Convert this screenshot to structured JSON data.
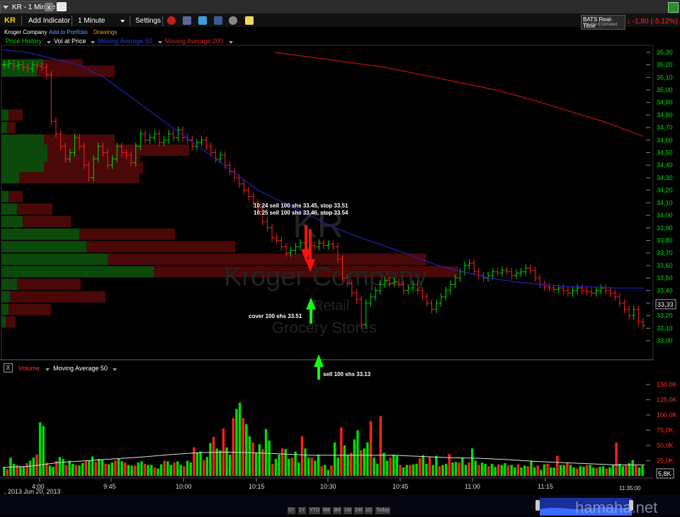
{
  "tab": {
    "title": "KR - 1 Minute",
    "close": "x"
  },
  "toolbar": {
    "symbol": "KR",
    "add_indicator": "Add Indicator",
    "interval": "1 Minute",
    "settings": "Settings"
  },
  "feed": {
    "label": "BATS Real-Time",
    "sub": "Volume Estimated",
    "change": "-1,80 (-5,12%)",
    "change_color": "#ff2a2a"
  },
  "links": {
    "company": "Kroger Company",
    "portfolio": "Add to Portfolio",
    "drawings": "Drawings"
  },
  "legend": {
    "price_history": "Price History",
    "vol_at_price": "Vol at Price",
    "ma50": "Moving Average 50",
    "ma200": "Moving Average 200"
  },
  "volume_legend": {
    "close": "X",
    "volume": "Volume",
    "ma50": "Moving Average 50"
  },
  "watermark_text": {
    "symbol": "KR",
    "name": "Kroger Company",
    "sector": "Retail",
    "industry": "Grocery Stores"
  },
  "annotations": {
    "sell1": "10:24 sell 100 shs 33.45, stop 33.51",
    "sell2": "10:25 sell 100 shs 33.46, stop 33.54",
    "cover": "cover 100 shs 33.51",
    "sell3": "sell 100 shs 33.13"
  },
  "date_label": ", 2013  Jun 20, 2013",
  "timestamp": "11:35:00",
  "range_buttons": [
    "5Y",
    "1Y",
    "YTD",
    "6M",
    "3M",
    "1M",
    "1W",
    "1D",
    "Today"
  ],
  "site_watermark": "hamaha.net",
  "colors": {
    "up": "#00dd00",
    "down": "#ff2020",
    "ma50": "#2020c0",
    "ma200": "#c01010",
    "vol_ma": "#dddddd",
    "axis_text": "#00e000",
    "vol_axis_text": "#ff3030"
  },
  "chart_data": [
    {
      "type": "candlestick",
      "title": "KR - 1 Minute",
      "x_ticks": [
        "4:00",
        "9:45",
        "10:00",
        "10:15",
        "10:30",
        "10:45",
        "11:00",
        "11:15"
      ],
      "y_ticks": [
        "35,30",
        "35,20",
        "35,10",
        "35,00",
        "34,90",
        "34,80",
        "34,70",
        "34,60",
        "34,50",
        "34,40",
        "34,30",
        "34,20",
        "34,10",
        "34,00",
        "33,90",
        "33,80",
        "33,70",
        "33,60",
        "33,50",
        "33,40",
        "33,30",
        "33,20",
        "33,10",
        "33,00"
      ],
      "ylim": [
        32.95,
        35.35
      ],
      "last_price": "33,33",
      "close_prices": [
        35.2,
        35.21,
        35.19,
        35.2,
        35.18,
        35.17,
        35.2,
        35.19,
        35.18,
        35.12,
        34.75,
        34.65,
        34.55,
        34.45,
        34.5,
        34.62,
        34.55,
        34.4,
        34.3,
        34.45,
        34.55,
        34.5,
        34.4,
        34.45,
        34.55,
        34.5,
        34.48,
        34.42,
        34.55,
        34.65,
        34.6,
        34.62,
        34.65,
        34.58,
        34.6,
        34.65,
        34.62,
        34.68,
        34.62,
        34.6,
        34.55,
        34.58,
        34.6,
        34.55,
        34.5,
        34.45,
        34.48,
        34.4,
        34.35,
        34.3,
        34.25,
        34.2,
        34.15,
        34.1,
        34.05,
        33.95,
        33.9,
        33.82,
        33.8,
        33.75,
        33.7,
        33.72,
        33.75,
        33.78,
        33.74,
        33.76,
        33.75,
        33.78,
        33.76,
        33.77,
        33.75,
        33.65,
        33.5,
        33.46,
        33.38,
        33.33,
        33.13,
        33.3,
        33.35,
        33.4,
        33.45,
        33.48,
        33.46,
        33.47,
        33.45,
        33.4,
        33.42,
        33.45,
        33.4,
        33.35,
        33.3,
        33.25,
        33.3,
        33.35,
        33.4,
        33.45,
        33.5,
        33.55,
        33.6,
        33.62,
        33.55,
        33.52,
        33.5,
        33.52,
        33.55,
        33.54,
        33.56,
        33.55,
        33.52,
        33.54,
        33.55,
        33.58,
        33.56,
        33.5,
        33.45,
        33.43,
        33.42,
        33.41,
        33.42,
        33.4,
        33.38,
        33.4,
        33.42,
        33.4,
        33.39,
        33.38,
        33.4,
        33.42,
        33.4,
        33.38,
        33.35,
        33.3,
        33.25,
        33.2,
        33.25,
        33.15,
        33.12
      ],
      "moving_average_50": [
        35.32,
        35.3,
        35.25,
        35.2,
        35.1,
        34.95,
        34.8,
        34.65,
        34.5,
        34.35,
        34.2,
        34.1,
        34.0,
        33.9,
        33.82,
        33.75,
        33.68,
        33.6,
        33.55,
        33.5,
        33.47,
        33.45,
        33.43,
        33.43,
        33.42,
        33.42
      ],
      "moving_average_200": [
        35.3,
        35.26,
        35.22,
        35.18,
        35.12,
        35.06,
        35.0,
        34.92,
        34.83,
        34.74,
        34.63
      ]
    },
    {
      "type": "bar",
      "title": "Volume",
      "y_ticks": [
        "150,0K",
        "125,0K",
        "100,0K",
        "75,0K",
        "50,0K",
        "25,0K"
      ],
      "ylim": [
        0,
        165000
      ],
      "last_value": "5,8K",
      "values": [
        14000,
        11000,
        30000,
        20000,
        18000,
        16000,
        15000,
        21000,
        25000,
        30000,
        35000,
        88000,
        82000,
        22000,
        17000,
        15000,
        25000,
        31000,
        28000,
        18000,
        25000,
        20000,
        18000,
        17000,
        21000,
        24000,
        25000,
        32000,
        23000,
        28000,
        27000,
        20000,
        19000,
        22000,
        25000,
        28000,
        24000,
        22000,
        18000,
        17000,
        17000,
        22000,
        24000,
        20000,
        18000,
        18000,
        14000,
        12000,
        19000,
        25000,
        24000,
        18000,
        22000,
        24000,
        18000,
        16000,
        25000,
        22000,
        47000,
        38000,
        40000,
        26000,
        31000,
        54000,
        64000,
        45000,
        42000,
        78000,
        47000,
        35000,
        95000,
        110000,
        120000,
        95000,
        85000,
        65000,
        55000,
        38000,
        52000,
        44000,
        77000,
        58000,
        20000,
        28000,
        35000,
        45000,
        44000,
        28000,
        30000,
        40000,
        22000,
        65000,
        45000,
        30000,
        30000,
        25000,
        35000,
        16000,
        18000,
        10000,
        17000,
        55000,
        30000,
        80000,
        50000,
        35000,
        38000,
        60000,
        75000,
        42000,
        45000,
        55000,
        90000,
        30000,
        20000,
        98000,
        38000,
        25000,
        30000,
        35000,
        33000,
        18000,
        14000,
        18000,
        18000,
        19000,
        20000,
        29000,
        34000,
        20000,
        32000,
        18000,
        33000,
        16000,
        18000,
        20000,
        36000,
        22000,
        23000,
        22000,
        30000,
        18000,
        22000,
        45000,
        25000,
        18000,
        22000,
        20000,
        16000,
        20000,
        15000,
        19000,
        18000,
        21000,
        17000,
        18000,
        14000,
        19000,
        14000,
        17000,
        16000,
        25000,
        14000,
        17000,
        10000,
        19000,
        20000,
        14000,
        14000,
        33000,
        18000,
        18000,
        22000,
        18000,
        14000,
        12000,
        16000,
        15000,
        18000,
        18000,
        14000,
        13000,
        15000,
        16000,
        12000,
        14000,
        18000,
        55000,
        20000,
        16000,
        17000,
        21000,
        26000,
        18000,
        14000,
        17000
      ],
      "moving_average_50": [
        14000,
        16000,
        22000,
        25000,
        28000,
        31000,
        35000,
        38000,
        39000,
        38000,
        36000,
        34000,
        34000,
        34000,
        34000,
        32000,
        30000,
        29000,
        27000,
        24000,
        22000,
        20000,
        18000,
        18000
      ]
    }
  ]
}
